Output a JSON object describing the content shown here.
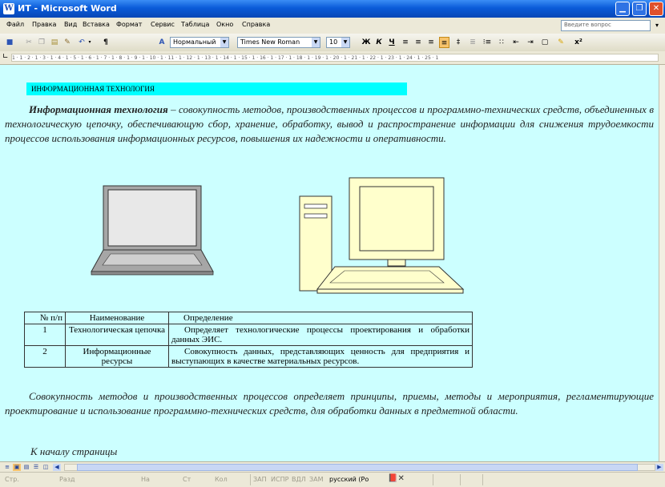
{
  "window": {
    "title": "ИТ - Microsoft Word",
    "app_icon": "W"
  },
  "menu": {
    "items": [
      "Файл",
      "Правка",
      "Вид",
      "Вставка",
      "Формат",
      "Сервис",
      "Таблица",
      "Окно",
      "Справка"
    ],
    "ask_placeholder": "Введите вопрос"
  },
  "toolbar": {
    "style": "Нормальный",
    "font": "Times New Roman",
    "size": "10"
  },
  "ruler": {
    "marks": "1 · 1 · 2 · 1 · 3 · 1 · 4 · 1 · 5 · 1 · 6 · 1 · 7 · 1 · 8 · 1 · 9 · 1 · 10 · 1 · 11 · 1 · 12 · 1 · 13 · 1 · 14 · 1 · 15 · 1 · 16 · 1 · 17 · 1 · 18 · 1 · 19 · 1 · 20 · 1 · 21 · 1 · 22 · 1 · 23 · 1 · 24 · 1 · 25 · 1"
  },
  "document": {
    "heading": "ИНФОРМАЦИОННАЯ ТЕХНОЛОГИЯ",
    "term": "Информационная технология",
    "definition": " – совокупность методов, производственных процессов и программно-технических средств, объединенных в технологическую цепочку, обеспечивающую сбор, хранение, обработку, вывод и распространение информации для снижения трудоемкости процессов использования информационных ресурсов, повышения их надежности и оперативности.",
    "table": {
      "headers": [
        "№ п/п",
        "Наименование",
        "Определение"
      ],
      "rows": [
        [
          "1",
          "Технологическая цепочка",
          "Определяет технологические процессы проектирования и обработки данных ЭИС."
        ],
        [
          "2",
          "Информационные ресурсы",
          "Совокупность данных, представляющих ценность для предприятия и выступающих в качестве материальных ресурсов."
        ]
      ]
    },
    "summary": "Совокупность методов и производственных процессов определяет принципы, приемы, методы и мероприятия, регламентирующие проектирование и использование программно-технических средств, для обработки данных в предметной области.",
    "top_link": "К началу страницы"
  },
  "status": {
    "page": "Стр.",
    "section": "Разд",
    "at": "На",
    "line": "Ст",
    "col": "Кол",
    "rec": "ЗАП",
    "trk": "ИСПР",
    "ext": "ВДЛ",
    "ovr": "ЗАМ",
    "lang": "русский (Ро"
  },
  "colors": {
    "page_bg": "#ccffff",
    "heading_highlight": "#00ffff",
    "title_bar": "#0a5bd9",
    "illustration_fill": "#ffffcc",
    "laptop_gray": "#a6a6a6"
  }
}
